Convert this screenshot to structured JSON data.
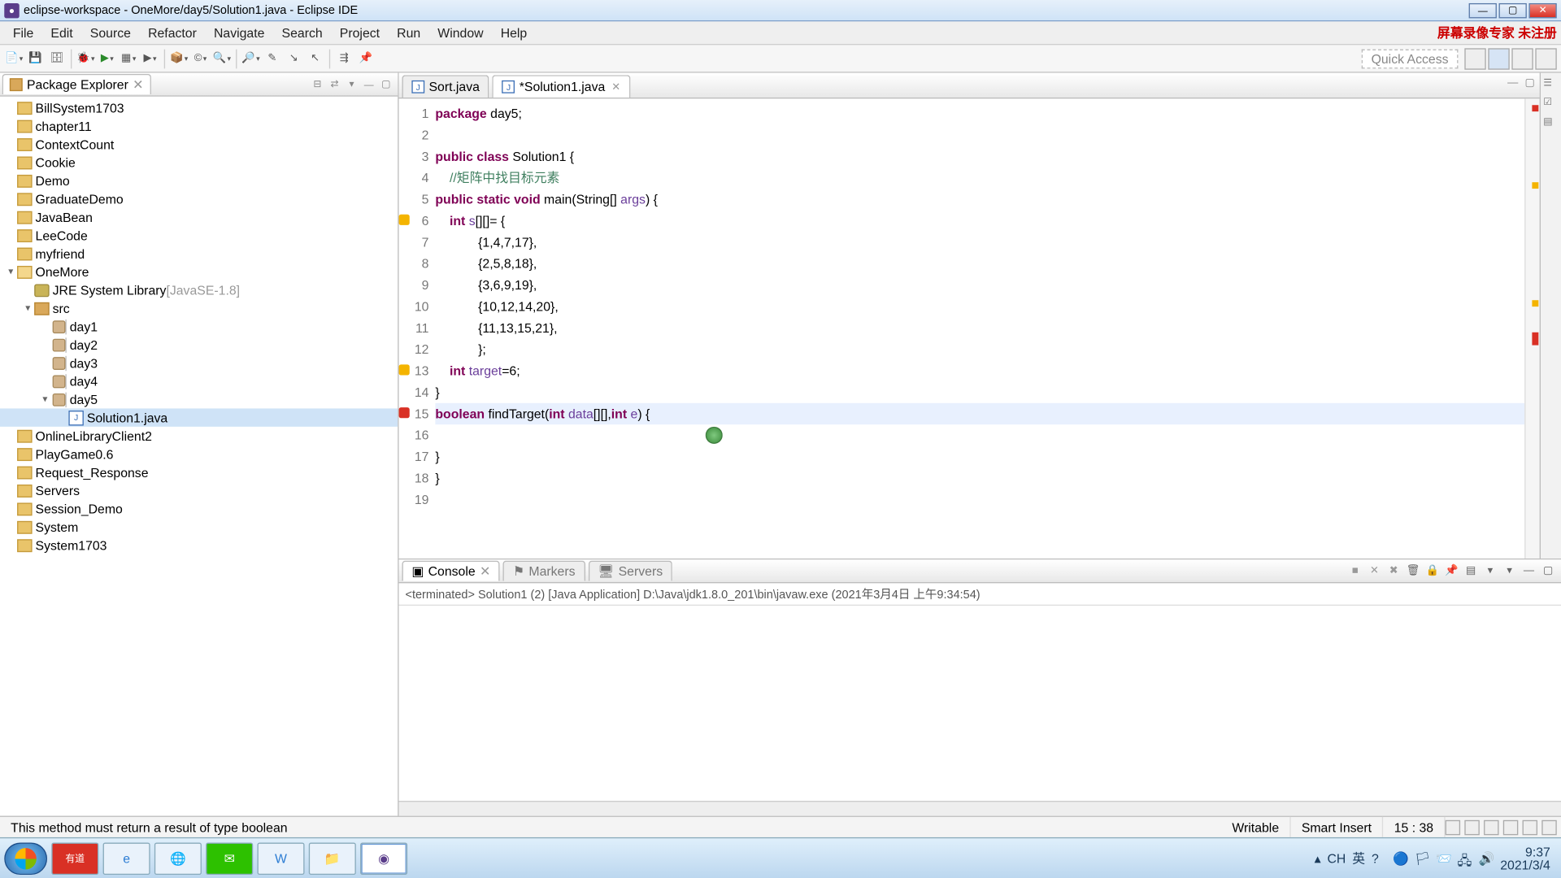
{
  "window": {
    "title": "eclipse-workspace - OneMore/day5/Solution1.java - Eclipse IDE"
  },
  "menu": {
    "items": [
      "File",
      "Edit",
      "Source",
      "Refactor",
      "Navigate",
      "Search",
      "Project",
      "Run",
      "Window",
      "Help"
    ],
    "watermark": "屏幕录像专家 未注册"
  },
  "toolbar": {
    "quick_access": "Quick Access"
  },
  "package_explorer": {
    "title": "Package Explorer",
    "tree": [
      {
        "label": "BillSystem1703",
        "type": "proj"
      },
      {
        "label": "chapter11",
        "type": "proj"
      },
      {
        "label": "ContextCount",
        "type": "proj"
      },
      {
        "label": "Cookie",
        "type": "proj"
      },
      {
        "label": "Demo",
        "type": "proj"
      },
      {
        "label": "GraduateDemo",
        "type": "proj"
      },
      {
        "label": "JavaBean",
        "type": "proj"
      },
      {
        "label": "LeeCode",
        "type": "proj"
      },
      {
        "label": "myfriend",
        "type": "proj"
      },
      {
        "label": "OneMore",
        "type": "projopen",
        "expanded": true,
        "children": [
          {
            "label": "JRE System Library",
            "suffix": "[JavaSE-1.8]",
            "type": "lib"
          },
          {
            "label": "src",
            "type": "folder",
            "expanded": true,
            "children": [
              {
                "label": "day1",
                "type": "pkg"
              },
              {
                "label": "day2",
                "type": "pkg"
              },
              {
                "label": "day3",
                "type": "pkg"
              },
              {
                "label": "day4",
                "type": "pkg"
              },
              {
                "label": "day5",
                "type": "pkg",
                "expanded": true,
                "children": [
                  {
                    "label": "Solution1.java",
                    "type": "java",
                    "selected": true
                  }
                ]
              }
            ]
          }
        ]
      },
      {
        "label": "OnlineLibraryClient2",
        "type": "proj"
      },
      {
        "label": "PlayGame0.6",
        "type": "proj"
      },
      {
        "label": "Request_Response",
        "type": "proj"
      },
      {
        "label": "Servers",
        "type": "proj"
      },
      {
        "label": "Session_Demo",
        "type": "proj"
      },
      {
        "label": "System",
        "type": "proj"
      },
      {
        "label": "System1703",
        "type": "proj"
      }
    ]
  },
  "editor": {
    "tabs": [
      {
        "label": "Sort.java",
        "active": false
      },
      {
        "label": "*Solution1.java",
        "active": true
      }
    ],
    "code": {
      "lines": [
        {
          "n": 1,
          "segments": [
            {
              "t": "package ",
              "c": "kw"
            },
            {
              "t": "day5;"
            }
          ]
        },
        {
          "n": 2,
          "segments": []
        },
        {
          "n": 3,
          "segments": [
            {
              "t": "public class ",
              "c": "kw"
            },
            {
              "t": "Solution1 {"
            }
          ]
        },
        {
          "n": 4,
          "segments": [
            {
              "t": "    "
            },
            {
              "t": "//矩阵中找目标元素",
              "c": "com"
            }
          ]
        },
        {
          "n": 5,
          "marker": "arrow",
          "segments": [
            {
              "t": "public static void ",
              "c": "kw"
            },
            {
              "t": "main(String[] "
            },
            {
              "t": "args",
              "c": "var"
            },
            {
              "t": ") {"
            }
          ]
        },
        {
          "n": 6,
          "marker": "warn",
          "segments": [
            {
              "t": "    "
            },
            {
              "t": "int ",
              "c": "kw"
            },
            {
              "t": "s",
              "c": "var"
            },
            {
              "t": "[][]= {"
            }
          ]
        },
        {
          "n": 7,
          "segments": [
            {
              "t": "            {1,4,7,17},"
            }
          ]
        },
        {
          "n": 8,
          "segments": [
            {
              "t": "            {2,5,8,18},"
            }
          ]
        },
        {
          "n": 9,
          "segments": [
            {
              "t": "            {3,6,9,19},"
            }
          ]
        },
        {
          "n": 10,
          "segments": [
            {
              "t": "            {10,12,14,20},"
            }
          ]
        },
        {
          "n": 11,
          "segments": [
            {
              "t": "            {11,13,15,21},"
            }
          ]
        },
        {
          "n": 12,
          "segments": [
            {
              "t": "            };"
            }
          ]
        },
        {
          "n": 13,
          "marker": "warn",
          "segments": [
            {
              "t": "    "
            },
            {
              "t": "int ",
              "c": "kw"
            },
            {
              "t": "target",
              "c": "var"
            },
            {
              "t": "=6;"
            }
          ]
        },
        {
          "n": 14,
          "segments": [
            {
              "t": "}"
            }
          ]
        },
        {
          "n": 15,
          "marker": "err",
          "hl": true,
          "segments": [
            {
              "t": "boolean ",
              "c": "kw"
            },
            {
              "t": "findTarget("
            },
            {
              "t": "int ",
              "c": "kw"
            },
            {
              "t": "data",
              "c": "var"
            },
            {
              "t": "[][],"
            },
            {
              "t": "int ",
              "c": "kw"
            },
            {
              "t": "e",
              "c": "var"
            },
            {
              "t": ") {"
            }
          ]
        },
        {
          "n": 16,
          "segments": []
        },
        {
          "n": 17,
          "segments": [
            {
              "t": "}"
            }
          ]
        },
        {
          "n": 18,
          "segments": [
            {
              "t": "}"
            }
          ]
        },
        {
          "n": 19,
          "segments": []
        }
      ]
    },
    "cursor_marker": {
      "line": 16,
      "col": 28
    }
  },
  "console": {
    "tabs": {
      "console": "Console",
      "markers": "Markers",
      "servers": "Servers"
    },
    "header": "<terminated> Solution1 (2) [Java Application] D:\\Java\\jdk1.8.0_201\\bin\\javaw.exe (2021年3月4日 上午9:34:54)"
  },
  "status_bar": {
    "message": "This method must return a result of type boolean",
    "writable": "Writable",
    "insert": "Smart Insert",
    "pos": "15 : 38"
  },
  "float_toolbar": {
    "lang": "英"
  },
  "tray": {
    "ime1": "CH",
    "ime2": "英",
    "time": "9:37",
    "date": "2021/3/4"
  }
}
